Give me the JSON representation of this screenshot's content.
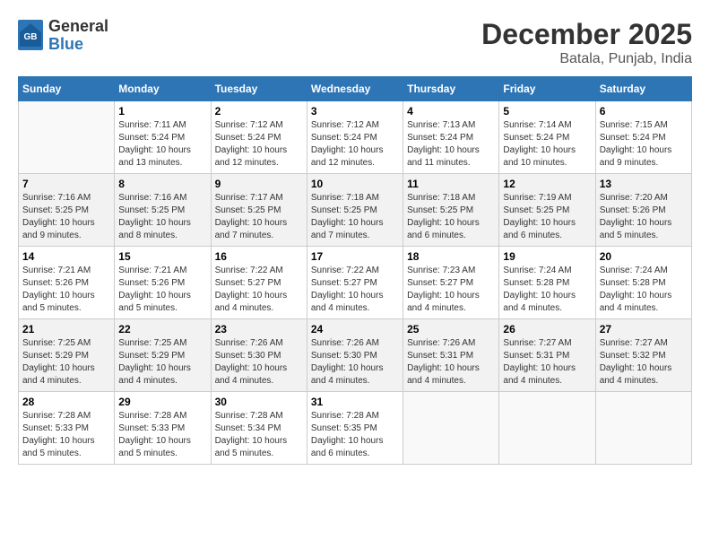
{
  "header": {
    "logo_line1": "General",
    "logo_line2": "Blue",
    "month": "December 2025",
    "location": "Batala, Punjab, India"
  },
  "weekdays": [
    "Sunday",
    "Monday",
    "Tuesday",
    "Wednesday",
    "Thursday",
    "Friday",
    "Saturday"
  ],
  "weeks": [
    [
      {
        "day": "",
        "info": ""
      },
      {
        "day": "1",
        "info": "Sunrise: 7:11 AM\nSunset: 5:24 PM\nDaylight: 10 hours\nand 13 minutes."
      },
      {
        "day": "2",
        "info": "Sunrise: 7:12 AM\nSunset: 5:24 PM\nDaylight: 10 hours\nand 12 minutes."
      },
      {
        "day": "3",
        "info": "Sunrise: 7:12 AM\nSunset: 5:24 PM\nDaylight: 10 hours\nand 12 minutes."
      },
      {
        "day": "4",
        "info": "Sunrise: 7:13 AM\nSunset: 5:24 PM\nDaylight: 10 hours\nand 11 minutes."
      },
      {
        "day": "5",
        "info": "Sunrise: 7:14 AM\nSunset: 5:24 PM\nDaylight: 10 hours\nand 10 minutes."
      },
      {
        "day": "6",
        "info": "Sunrise: 7:15 AM\nSunset: 5:24 PM\nDaylight: 10 hours\nand 9 minutes."
      }
    ],
    [
      {
        "day": "7",
        "info": "Sunrise: 7:16 AM\nSunset: 5:25 PM\nDaylight: 10 hours\nand 9 minutes."
      },
      {
        "day": "8",
        "info": "Sunrise: 7:16 AM\nSunset: 5:25 PM\nDaylight: 10 hours\nand 8 minutes."
      },
      {
        "day": "9",
        "info": "Sunrise: 7:17 AM\nSunset: 5:25 PM\nDaylight: 10 hours\nand 7 minutes."
      },
      {
        "day": "10",
        "info": "Sunrise: 7:18 AM\nSunset: 5:25 PM\nDaylight: 10 hours\nand 7 minutes."
      },
      {
        "day": "11",
        "info": "Sunrise: 7:18 AM\nSunset: 5:25 PM\nDaylight: 10 hours\nand 6 minutes."
      },
      {
        "day": "12",
        "info": "Sunrise: 7:19 AM\nSunset: 5:25 PM\nDaylight: 10 hours\nand 6 minutes."
      },
      {
        "day": "13",
        "info": "Sunrise: 7:20 AM\nSunset: 5:26 PM\nDaylight: 10 hours\nand 5 minutes."
      }
    ],
    [
      {
        "day": "14",
        "info": "Sunrise: 7:21 AM\nSunset: 5:26 PM\nDaylight: 10 hours\nand 5 minutes."
      },
      {
        "day": "15",
        "info": "Sunrise: 7:21 AM\nSunset: 5:26 PM\nDaylight: 10 hours\nand 5 minutes."
      },
      {
        "day": "16",
        "info": "Sunrise: 7:22 AM\nSunset: 5:27 PM\nDaylight: 10 hours\nand 4 minutes."
      },
      {
        "day": "17",
        "info": "Sunrise: 7:22 AM\nSunset: 5:27 PM\nDaylight: 10 hours\nand 4 minutes."
      },
      {
        "day": "18",
        "info": "Sunrise: 7:23 AM\nSunset: 5:27 PM\nDaylight: 10 hours\nand 4 minutes."
      },
      {
        "day": "19",
        "info": "Sunrise: 7:24 AM\nSunset: 5:28 PM\nDaylight: 10 hours\nand 4 minutes."
      },
      {
        "day": "20",
        "info": "Sunrise: 7:24 AM\nSunset: 5:28 PM\nDaylight: 10 hours\nand 4 minutes."
      }
    ],
    [
      {
        "day": "21",
        "info": "Sunrise: 7:25 AM\nSunset: 5:29 PM\nDaylight: 10 hours\nand 4 minutes."
      },
      {
        "day": "22",
        "info": "Sunrise: 7:25 AM\nSunset: 5:29 PM\nDaylight: 10 hours\nand 4 minutes."
      },
      {
        "day": "23",
        "info": "Sunrise: 7:26 AM\nSunset: 5:30 PM\nDaylight: 10 hours\nand 4 minutes."
      },
      {
        "day": "24",
        "info": "Sunrise: 7:26 AM\nSunset: 5:30 PM\nDaylight: 10 hours\nand 4 minutes."
      },
      {
        "day": "25",
        "info": "Sunrise: 7:26 AM\nSunset: 5:31 PM\nDaylight: 10 hours\nand 4 minutes."
      },
      {
        "day": "26",
        "info": "Sunrise: 7:27 AM\nSunset: 5:31 PM\nDaylight: 10 hours\nand 4 minutes."
      },
      {
        "day": "27",
        "info": "Sunrise: 7:27 AM\nSunset: 5:32 PM\nDaylight: 10 hours\nand 4 minutes."
      }
    ],
    [
      {
        "day": "28",
        "info": "Sunrise: 7:28 AM\nSunset: 5:33 PM\nDaylight: 10 hours\nand 5 minutes."
      },
      {
        "day": "29",
        "info": "Sunrise: 7:28 AM\nSunset: 5:33 PM\nDaylight: 10 hours\nand 5 minutes."
      },
      {
        "day": "30",
        "info": "Sunrise: 7:28 AM\nSunset: 5:34 PM\nDaylight: 10 hours\nand 5 minutes."
      },
      {
        "day": "31",
        "info": "Sunrise: 7:28 AM\nSunset: 5:35 PM\nDaylight: 10 hours\nand 6 minutes."
      },
      {
        "day": "",
        "info": ""
      },
      {
        "day": "",
        "info": ""
      },
      {
        "day": "",
        "info": ""
      }
    ]
  ]
}
